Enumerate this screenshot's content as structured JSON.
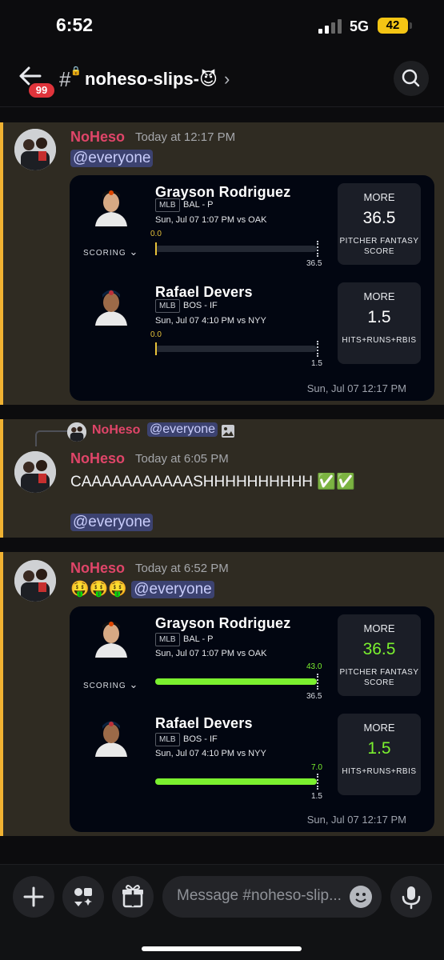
{
  "status_bar": {
    "time": "6:52",
    "network": "5G",
    "battery": "42"
  },
  "header": {
    "unread_badge": "99",
    "channel_name": "noheso-slips-😈"
  },
  "messages": [
    {
      "username": "NoHeso",
      "timestamp": "Today at 12:17 PM",
      "mention": "@everyone",
      "slip": {
        "scoring_label": "SCORING",
        "date": "Sun, Jul 07 12:17 PM",
        "picks": [
          {
            "name": "Grayson Rodriguez",
            "league": "MLB",
            "team": "BAL - P",
            "game": "Sun, Jul 07 1:07 PM  vs OAK",
            "current": "0.0",
            "line_label": "36.5",
            "progress": 0,
            "direction": "MORE",
            "line": "36.5",
            "stat": "PITCHER FANTASY SCORE"
          },
          {
            "name": "Rafael Devers",
            "league": "MLB",
            "team": "BOS - IF",
            "game": "Sun, Jul 07 4:10 PM  vs NYY",
            "current": "0.0",
            "line_label": "1.5",
            "progress": 0,
            "direction": "MORE",
            "line": "1.5",
            "stat": "HITS+RUNS+RBIS"
          }
        ]
      }
    },
    {
      "reply_preview": {
        "username": "NoHeso",
        "mention": "@everyone"
      },
      "username": "NoHeso",
      "timestamp": "Today at 6:05 PM",
      "text": "CAAAAAAAAAAASHHHHHHHHHH ✅✅",
      "mention": "@everyone"
    },
    {
      "username": "NoHeso",
      "timestamp": "Today at 6:52 PM",
      "emojis": "🤑🤑🤑",
      "mention": "@everyone",
      "slip": {
        "scoring_label": "SCORING",
        "date": "Sun, Jul 07 12:17 PM",
        "picks": [
          {
            "name": "Grayson Rodriguez",
            "league": "MLB",
            "team": "BAL - P",
            "game": "Sun, Jul 07 1:07 PM  vs OAK",
            "current": "43.0",
            "line_label": "36.5",
            "progress": 1,
            "direction": "MORE",
            "line": "36.5",
            "stat": "PITCHER FANTASY SCORE"
          },
          {
            "name": "Rafael Devers",
            "league": "MLB",
            "team": "BOS - IF",
            "game": "Sun, Jul 07 4:10 PM  vs NYY",
            "current": "7.0",
            "line_label": "1.5",
            "progress": 1,
            "direction": "MORE",
            "line": "1.5",
            "stat": "HITS+RUNS+RBIS"
          }
        ]
      }
    }
  ],
  "composer": {
    "placeholder": "Message #noheso-slip..."
  },
  "colors": {
    "accent_hit": "#7bf02f",
    "mention_bg": "#3c4270",
    "username": "#e04569",
    "highlight_border": "#f0b232"
  }
}
